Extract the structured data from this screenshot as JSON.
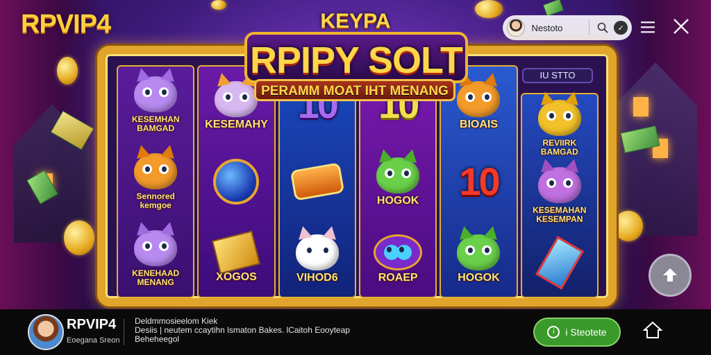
{
  "brand": {
    "logo": "RPVIP4"
  },
  "topbar": {
    "user_name": "Nestoto",
    "badge": "✓"
  },
  "game": {
    "title_small": "KEYPA",
    "title_main": "RPIPY SOLT",
    "banner": "PERAMM MOAT IHT MENANG",
    "reel_header": "IU STTO",
    "reels": [
      [
        {
          "kind": "cat",
          "color": "#b88af0",
          "ear": "#a06ae0",
          "label": "KESEMHAN\nBAMGAD"
        },
        {
          "kind": "cat",
          "color": "#f29a2a",
          "ear": "#e07a0a",
          "label": "Sennored\nkemgoe"
        },
        {
          "kind": "cat",
          "color": "#b88af0",
          "ear": "#a06ae0",
          "label": "KENEHAAD\nMENANG"
        }
      ],
      [
        {
          "kind": "cat",
          "color": "#d8b8f0",
          "ear": "#f0a030",
          "label": "KESEMAHY"
        },
        {
          "kind": "ball",
          "label": ""
        },
        {
          "kind": "gold",
          "label": "XOGOS"
        }
      ],
      [
        {
          "kind": "ten",
          "tone": "purple",
          "label": "10"
        },
        {
          "kind": "bar",
          "label": ""
        },
        {
          "kind": "cat",
          "color": "#ffffff",
          "ear": "#f0c0d0",
          "label": "VIHOD6"
        }
      ],
      [
        {
          "kind": "ten",
          "tone": "yellow",
          "label": "10"
        },
        {
          "kind": "cat",
          "color": "#6ad04a",
          "ear": "#4ab02a",
          "label": "HOGOK"
        },
        {
          "kind": "eyes",
          "label": "ROAEP"
        }
      ],
      [
        {
          "kind": "cat",
          "color": "#f29a2a",
          "ear": "#e07a0a",
          "label": "BIOAIS"
        },
        {
          "kind": "ten",
          "tone": "red",
          "label": "10"
        },
        {
          "kind": "cat",
          "color": "#6ad04a",
          "ear": "#4ab02a",
          "label": "HOGOK"
        }
      ],
      [
        {
          "kind": "cat",
          "color": "#f2c02a",
          "ear": "#e0a00a",
          "label": "REVIIRK\nBAMGAD"
        },
        {
          "kind": "cat",
          "color": "#c070e0",
          "ear": "#a050c0",
          "label": "KESEMAHAN\nKESEMPAN"
        },
        {
          "kind": "card",
          "label": ""
        }
      ]
    ]
  },
  "bottombar": {
    "title": "RPVIP4",
    "subtitle": "Eoegana Sreon",
    "desc_lines": [
      "Deldmmosieelom Kiek",
      "Desiis | neutem ccaytihn lsmaton Bakes. lCaitoh Eooyteap",
      "Beheheegol"
    ],
    "cta_icon": "i",
    "cta_label": "i Steotete"
  },
  "colors": {
    "accent_gold": "#e0a52a",
    "cta_green": "#3a9a2a",
    "bottom_bg": "#0a0a0a"
  },
  "icons": {
    "search": "search-icon",
    "menu": "menu-icon",
    "close": "close-icon",
    "scroll_up": "arrow-up-icon",
    "home": "home-icon"
  }
}
